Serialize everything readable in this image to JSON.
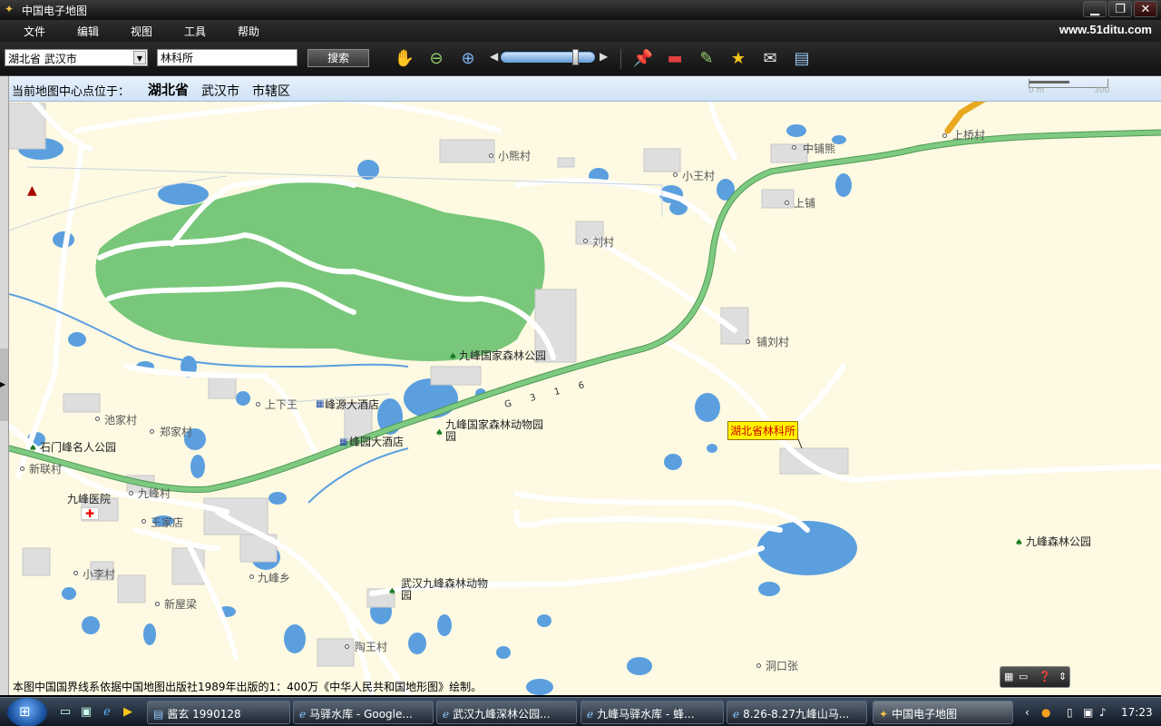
{
  "window": {
    "title": "中国电子地图",
    "minimize": "▁",
    "maximize": "❐",
    "close": "✕"
  },
  "menu": {
    "items": [
      "文件",
      "编辑",
      "视图",
      "工具",
      "帮助"
    ],
    "site_url": "www.51ditu.com"
  },
  "toolbar": {
    "region_select": "湖北省 武汉市",
    "search_value": "林科所",
    "search_button": "搜索",
    "tools": [
      "hand-pan-icon",
      "zoom-out-icon",
      "zoom-in-icon",
      "pushpin-icon",
      "measure-ruler-icon",
      "edit-pencil-icon",
      "favorite-star-icon",
      "email-icon",
      "print-icon"
    ],
    "zoom_level_fraction": 0.8
  },
  "info_bar": {
    "label": "当前地图中心点位于：",
    "province": "湖北省",
    "city": "武汉市",
    "district": "市辖区"
  },
  "scale": {
    "start": "0 m",
    "end": "300"
  },
  "map": {
    "places": [
      "小熊村",
      "小王村",
      "中铺熊",
      "上铺",
      "刘村",
      "铺刘村",
      "上桥村",
      "池家村",
      "郑家村",
      "上下王",
      "新联村",
      "九峰村",
      "王家店",
      "小李村",
      "新屋梁",
      "九峰乡",
      "陶王村",
      "洞口张"
    ],
    "pois": {
      "forest_park": "九峰国家森林公园",
      "zoo": "九峰国家森林动物园",
      "zoo_b": "园",
      "stone_gate": "石门峰名人公园",
      "hotel_1": "峰源大酒店",
      "hotel_2": "峰园大酒店",
      "hospital": "九峰医院",
      "wuhan_zoo": "武汉九峰森林动物",
      "wuhan_zoo_b": "园",
      "jiufeng_park": "九峰森林公园"
    },
    "target": "湖北省林科所",
    "road_label": "G 3 1 6",
    "footnote": "本图中国国界线系依据中国地图出版社1989年出版的1：400万《中华人民共和国地形图》绘制。"
  },
  "taskbar": {
    "tasks": [
      "酱玄 1990128",
      "马驿水库 - Google...",
      "武汉九峰深林公园...",
      "九峰马驿水库 - 蜂...",
      "8.26-8.27九峰山马...",
      "中国电子地图"
    ],
    "clock": "17:23"
  }
}
